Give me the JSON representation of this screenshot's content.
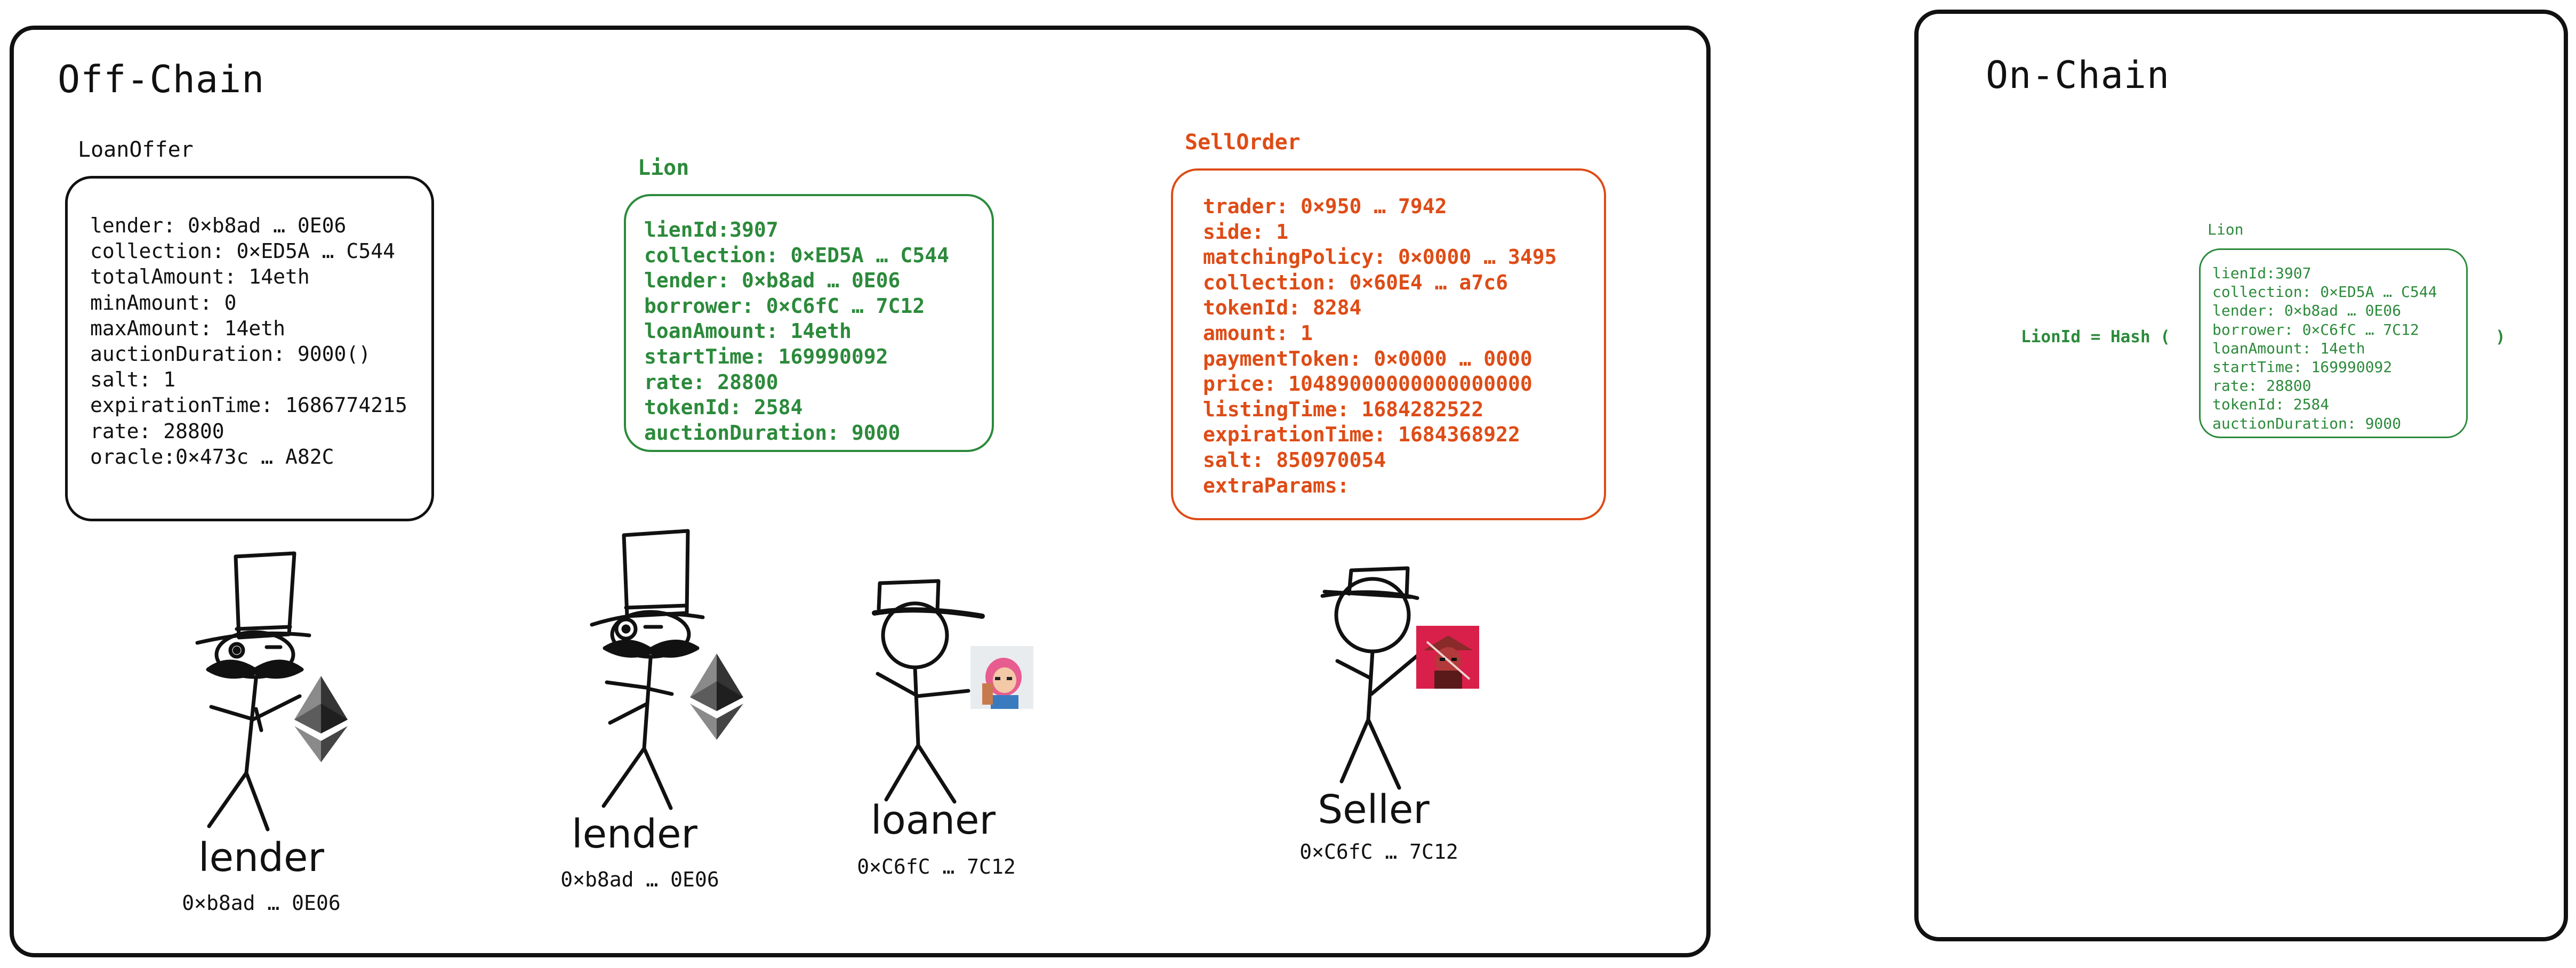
{
  "offchain": {
    "title": "Off-Chain",
    "loan_offer": {
      "title": "LoanOffer",
      "lines": [
        "lender: 0×b8ad … 0E06",
        "collection: 0×ED5A … C544",
        "totalAmount: 14eth",
        "minAmount: 0",
        "maxAmount: 14eth",
        "auctionDuration: 9000()",
        "salt: 1",
        "expirationTime: 1686774215",
        "rate: 28800",
        "oracle:0×473c … A82C"
      ]
    },
    "lion": {
      "title": "Lion",
      "lines": [
        "lienId:3907",
        "collection: 0×ED5A … C544",
        "lender: 0×b8ad … 0E06",
        "borrower: 0×C6fC … 7C12",
        "loanAmount: 14eth",
        "startTime: 169990092",
        "rate: 28800",
        "tokenId: 2584",
        "auctionDuration: 9000"
      ]
    },
    "sell_order": {
      "title": "SellOrder",
      "lines": [
        "trader: 0×950 … 7942",
        "side: 1",
        "matchingPolicy: 0×0000 … 3495",
        "collection: 0×60E4 … a7c6",
        "tokenId: 8284",
        "amount: 1",
        "paymentToken: 0×0000 … 0000",
        "price: 10489000000000000000",
        "listingTime: 1684282522",
        "expirationTime: 1684368922",
        "salt: 850970054",
        "extraParams:"
      ]
    },
    "people": [
      {
        "name": "lender",
        "address": "0×b8ad … 0E06"
      },
      {
        "name": "lender",
        "address": "0×b8ad … 0E06"
      },
      {
        "name": "loaner",
        "address": "0×C6fC … 7C12"
      },
      {
        "name": "Seller",
        "address": "0×C6fC … 7C12"
      }
    ]
  },
  "onchain": {
    "title": "On-Chain",
    "formula_prefix": "LionId = Hash (",
    "formula_suffix": ")",
    "lion": {
      "title": "Lion",
      "lines": [
        "lienId:3907",
        "collection: 0×ED5A … C544",
        "lender: 0×b8ad … 0E06",
        "borrower: 0×C6fC … 7C12",
        "loanAmount: 14eth",
        "startTime: 169990092",
        "rate: 28800",
        "tokenId: 2584",
        "auctionDuration: 9000"
      ]
    }
  },
  "colors": {
    "green": "#2c8a3b",
    "orange": "#de4c16",
    "ink": "#111111"
  }
}
